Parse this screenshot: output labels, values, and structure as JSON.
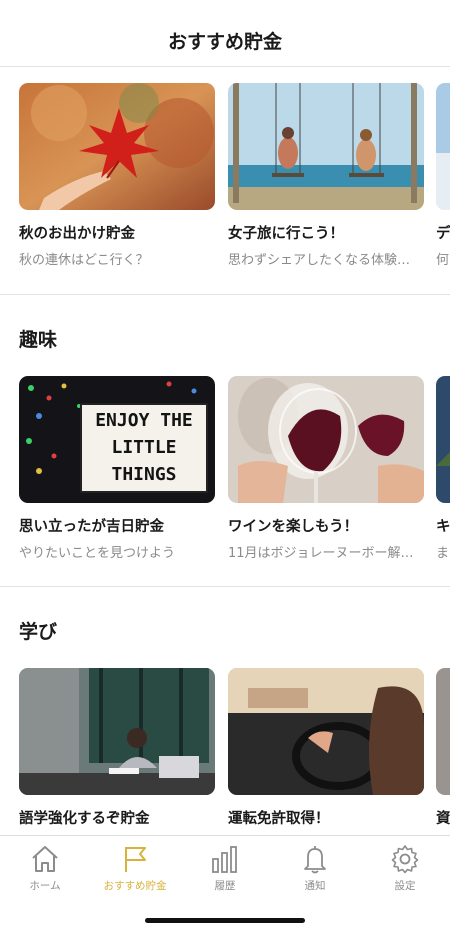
{
  "header": {
    "title": "おすすめ貯金"
  },
  "sections": [
    {
      "title": "",
      "cards": [
        {
          "title": "秋のお出かけ貯金",
          "subtitle": "秋の連休はどこ行く？",
          "image": "autumn-leaf-photo"
        },
        {
          "title": "女子旅に行こう！",
          "subtitle": "思わずシェアしたくなる体験…",
          "image": "beach-swing-photo"
        },
        {
          "title": "デ",
          "subtitle": "何",
          "image": "sky-photo"
        }
      ]
    },
    {
      "title": "趣味",
      "cards": [
        {
          "title": "思い立ったが吉日貯金",
          "subtitle": "やりたいことを見つけよう",
          "image": "lightbox-sign-photo",
          "sign_lines": [
            "ENJOY THE",
            "LITTLE",
            "THINGS"
          ]
        },
        {
          "title": "ワインを楽しもう！",
          "subtitle": "11月はボジョレーヌーボー解…",
          "image": "wine-toast-photo"
        },
        {
          "title": "キ",
          "subtitle": "ま",
          "image": "mountain-photo"
        }
      ]
    },
    {
      "title": "学び",
      "cards": [
        {
          "title": "語学強化するぞ貯金",
          "subtitle": "",
          "image": "study-desk-photo"
        },
        {
          "title": "運転免許取得！",
          "subtitle": "",
          "image": "driving-photo"
        },
        {
          "title": "資",
          "subtitle": "",
          "image": "partial-photo"
        }
      ]
    }
  ],
  "tabbar": {
    "items": [
      {
        "label": "ホーム",
        "icon": "home-icon"
      },
      {
        "label": "おすすめ貯金",
        "icon": "flag-icon",
        "active": true
      },
      {
        "label": "履歴",
        "icon": "bar-chart-icon"
      },
      {
        "label": "通知",
        "icon": "bell-icon"
      },
      {
        "label": "設定",
        "icon": "gear-icon"
      }
    ]
  },
  "colors": {
    "accent": "#d8b23a",
    "inactive": "#8c8c8c",
    "divider": "#e2e2e2"
  }
}
